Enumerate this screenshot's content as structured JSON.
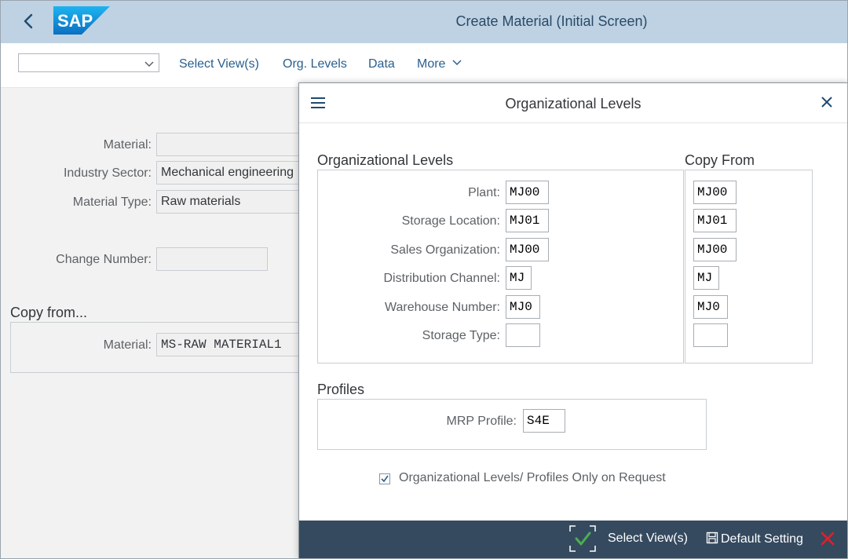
{
  "shell": {
    "title": "Create Material (Initial Screen)",
    "logo_text": "SAP"
  },
  "toolbar": {
    "select_value": "",
    "select_views": "Select View(s)",
    "org_levels": "Org. Levels",
    "data": "Data",
    "more": "More"
  },
  "form": {
    "material_label": "Material:",
    "material_value": "",
    "industry_label": "Industry Sector:",
    "industry_value": "Mechanical engineering",
    "type_label": "Material Type:",
    "type_value": "Raw materials",
    "change_label": "Change Number:",
    "change_value": "",
    "copy_heading": "Copy from...",
    "copy_material_label": "Material:",
    "copy_material_value": "MS-RAW MATERIAL1"
  },
  "dialog": {
    "title": "Organizational Levels",
    "org_heading": "Organizational Levels",
    "copy_heading": "Copy From",
    "rows": [
      {
        "label": "Plant:",
        "value": "MJ00",
        "copy": "MJ00"
      },
      {
        "label": "Storage Location:",
        "value": "MJ01",
        "copy": "MJ01"
      },
      {
        "label": "Sales Organization:",
        "value": "MJ00",
        "copy": "MJ00"
      },
      {
        "label": "Distribution Channel:",
        "value": "MJ",
        "copy": "MJ"
      },
      {
        "label": "Warehouse Number:",
        "value": "MJ0",
        "copy": "MJ0"
      },
      {
        "label": "Storage Type:",
        "value": "",
        "copy": ""
      }
    ],
    "profiles_heading": "Profiles",
    "mrp_label": "MRP Profile:",
    "mrp_value": "S4E",
    "checkbox_label": "Organizational Levels/ Profiles Only on Request",
    "checkbox_checked": true,
    "footer": {
      "select_views": "Select View(s)",
      "default_setting": "Default Setting"
    }
  },
  "colors": {
    "shell_bg": "#bed2e3",
    "footer_bg": "#354a5f",
    "ok_green": "#2b7d2b",
    "cancel_red": "#e0202a",
    "link_blue": "#2a5f8f"
  }
}
